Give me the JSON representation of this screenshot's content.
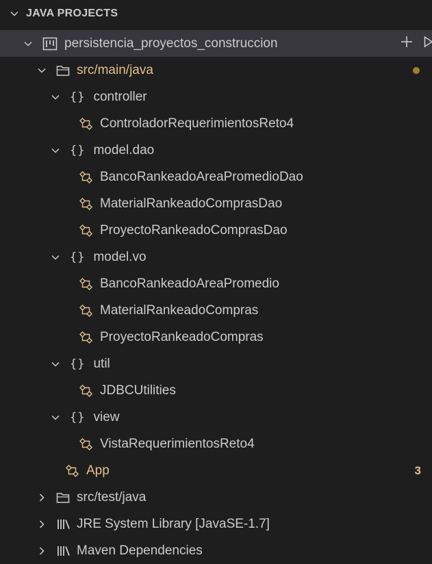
{
  "section": {
    "title": "JAVA PROJECTS"
  },
  "project": {
    "name": "persistencia_proyectos_construccion"
  },
  "colors": {
    "modified": "#e2c08d",
    "text": "#cccccc",
    "selected_row": "#37373d",
    "class_icon": "#e2c08d"
  },
  "tree": {
    "src_main": {
      "label": "src/main/java"
    },
    "controller": {
      "label": "controller",
      "classes": [
        "ControladorRequerimientosReto4"
      ]
    },
    "model_dao": {
      "label": "model.dao",
      "classes": [
        "BancoRankeadoAreaPromedioDao",
        "MaterialRankeadoComprasDao",
        "ProyectoRankeadoComprasDao"
      ]
    },
    "model_vo": {
      "label": "model.vo",
      "classes": [
        "BancoRankeadoAreaPromedio",
        "MaterialRankeadoCompras",
        "ProyectoRankeadoCompras"
      ]
    },
    "util": {
      "label": "util",
      "classes": [
        "JDBCUtilities"
      ]
    },
    "view": {
      "label": "view",
      "classes": [
        "VistaRequerimientosReto4"
      ]
    },
    "app": {
      "label": "App",
      "problems": "3"
    },
    "src_test": {
      "label": "src/test/java"
    },
    "jre": {
      "label": "JRE System Library [JavaSE-1.7]"
    },
    "maven": {
      "label": "Maven Dependencies"
    }
  }
}
